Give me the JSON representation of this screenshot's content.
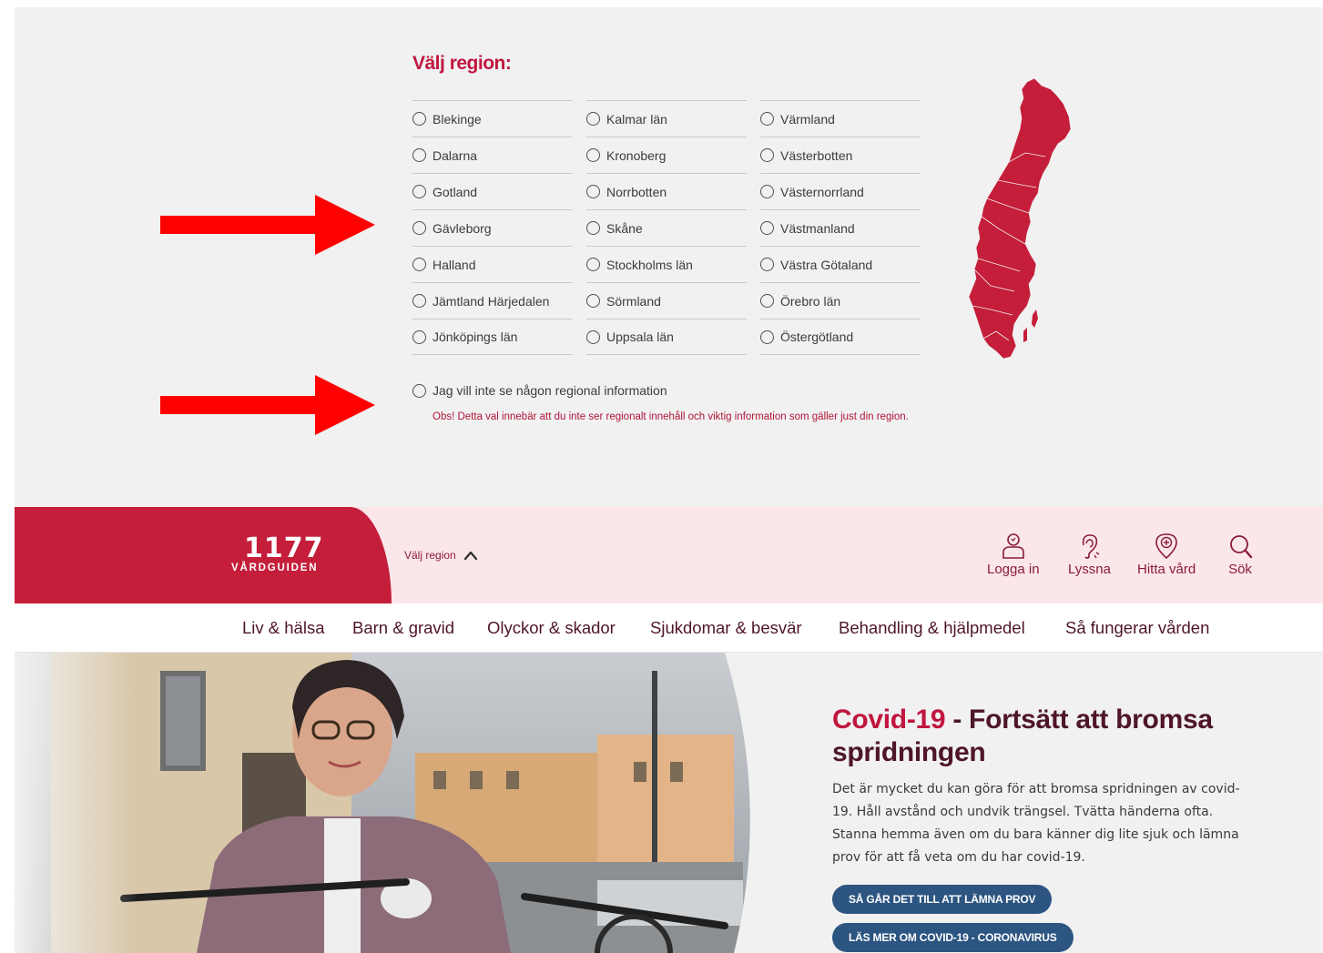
{
  "region_picker": {
    "heading": "Välj region:",
    "columns": [
      [
        "Blekinge",
        "Dalarna",
        "Gotland",
        "Gävleborg",
        "Halland",
        "Jämtland Härjedalen",
        "Jönköpings län"
      ],
      [
        "Kalmar län",
        "Kronoberg",
        "Norrbotten",
        "Skåne",
        "Stockholms län",
        "Sörmland",
        "Uppsala län"
      ],
      [
        "Värmland",
        "Västerbotten",
        "Västernorrland",
        "Västmanland",
        "Västra Götaland",
        "Örebro län",
        "Östergötland"
      ]
    ],
    "no_region_label": "Jag vill inte se någon regional information",
    "no_region_note": "Obs! Detta val innebär att du inte ser regionalt innehåll och viktig information som gäller just din region."
  },
  "header": {
    "logo_number": "1177",
    "logo_text": "VÅRDGUIDEN",
    "region_toggle": "Välj region",
    "actions": [
      "Logga in",
      "Lyssna",
      "Hitta vård",
      "Sök"
    ]
  },
  "nav": {
    "items": [
      "Liv & hälsa",
      "Barn & gravid",
      "Olyckor & skador",
      "Sjukdomar & besvär",
      "Behandling & hjälpmedel",
      "Så fungerar vården"
    ]
  },
  "hero": {
    "title_accent": "Covid-19",
    "title_rest": " - Fortsätt att bromsa spridningen",
    "text": "Det är mycket du kan göra för att bromsa spridningen av covid-19. Håll avstånd och undvik trängsel. Tvätta händerna ofta. Stanna hemma även om du bara känner dig lite sjuk och lämna prov för att få veta om du har covid-19.",
    "button_1": "SÅ GÅR DET TILL ATT LÄMNA PROV",
    "button_2": "LÄS MER OM COVID-19 - CORONAVIRUS"
  },
  "colors": {
    "brand_red": "#c41e3a",
    "header_tint": "#fbe7ea",
    "nav_text": "#4e1628",
    "button_blue": "#2c5581",
    "annotation_arrow": "#ff0000"
  }
}
